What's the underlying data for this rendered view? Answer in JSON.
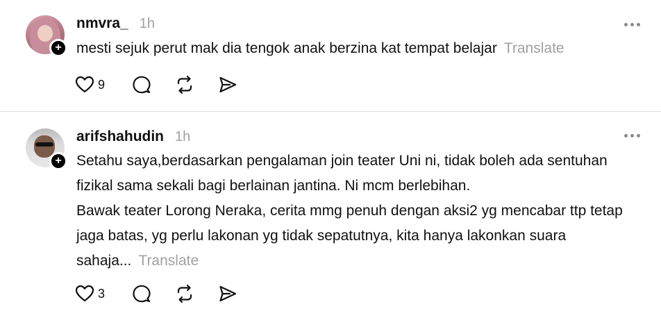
{
  "posts": [
    {
      "username": "nmvra_",
      "time": "1h",
      "paragraphs": [
        "mesti sejuk perut mak dia tengok anak berzina kat tempat belajar"
      ],
      "translate_label": "Translate",
      "likes": "9",
      "icons": [
        "heart-icon",
        "comment-icon",
        "repost-icon",
        "share-icon",
        "more-icon",
        "plus-icon"
      ]
    },
    {
      "username": "arifshahudin",
      "time": "1h",
      "paragraphs": [
        "Setahu saya,berdasarkan pengalaman join teater Uni ni, tidak boleh ada sentuhan fizikal sama sekali bagi berlainan jantina. Ni mcm berlebihan.",
        "Bawak teater Lorong Neraka, cerita mmg penuh dengan aksi2 yg mencabar ttp tetap jaga batas, yg perlu lakonan yg tidak sepatutnya, kita hanya lakonkan suara sahaja..."
      ],
      "translate_label": "Translate",
      "likes": "3",
      "icons": [
        "heart-icon",
        "comment-icon",
        "repost-icon",
        "share-icon",
        "more-icon",
        "plus-icon"
      ]
    }
  ]
}
